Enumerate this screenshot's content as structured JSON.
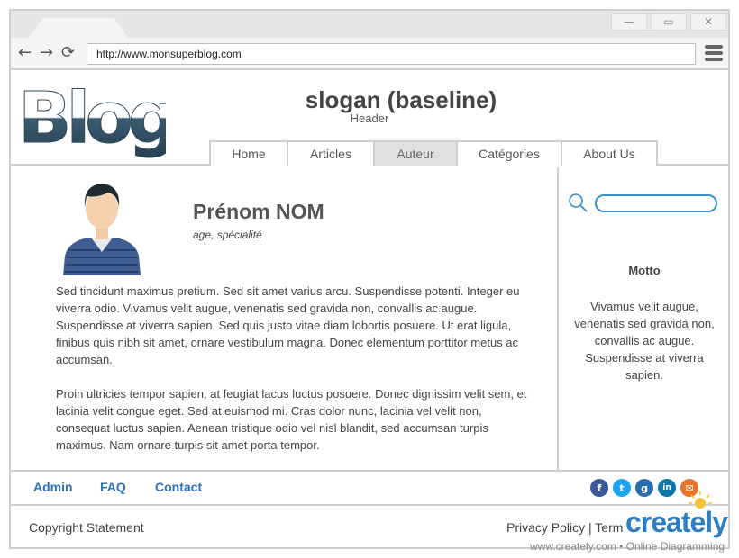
{
  "browser": {
    "url": "http://www.monsuperblog.com",
    "window_controls": [
      "minimize-icon",
      "maximize-icon",
      "close-icon"
    ]
  },
  "header": {
    "logo_text": "Blog",
    "slogan": "slogan (baseline)",
    "label": "Header"
  },
  "nav": {
    "items": [
      {
        "label": "Home",
        "active": false
      },
      {
        "label": "Articles",
        "active": false
      },
      {
        "label": "Auteur",
        "active": true
      },
      {
        "label": "Catégories",
        "active": false
      },
      {
        "label": "About Us",
        "active": false
      }
    ]
  },
  "author": {
    "name": "Prénom NOM",
    "subtitle": "age, spécialité"
  },
  "content": {
    "paragraph1": "Sed tincidunt maximus pretium. Sed sit amet varius arcu. Suspendisse potenti. Integer eu viverra odio. Vivamus velit augue, venenatis sed gravida non, convallis ac augue. Suspendisse at viverra sapien. Sed quis justo vitae diam lobortis posuere. Ut erat ligula, finibus quis nibh sit amet, ornare vestibulum magna. Donec elementum porttitor metus ac accumsan.",
    "paragraph2": "Proin ultricies tempor sapien, at feugiat lacus luctus posuere. Donec dignissim velit sem, et lacinia velit congue eget. Sed at euismod mi. Cras dolor nunc, lacinia vel velit non, consequat luctus sapien. Aenean tristique odio vel nisl blandit, sed accumsan turpis maximus. Nam ornare turpis sit amet porta tempor."
  },
  "sidebar": {
    "motto": "Motto",
    "text": "Vivamus velit augue, venenatis sed gravida non, convallis ac augue. Suspendisse at viverra sapien."
  },
  "footer": {
    "links": [
      "Admin",
      "FAQ",
      "Contact"
    ],
    "social": [
      {
        "icon": "facebook-icon",
        "glyph": "f",
        "color": "#3b5998"
      },
      {
        "icon": "twitter-icon",
        "glyph": "t",
        "color": "#1da1f2"
      },
      {
        "icon": "github-icon",
        "glyph": "g",
        "color": "#2a6db0"
      },
      {
        "icon": "linkedin-icon",
        "glyph": "in",
        "color": "#0e76a8"
      },
      {
        "icon": "email-icon",
        "glyph": "✉",
        "color": "#e8742c"
      }
    ],
    "copyright": "Copyright Statement",
    "policy": "Privacy Policy | Term"
  },
  "watermark": {
    "brand": "creately",
    "sub": "www.creately.com • Online Diagramming"
  },
  "colors": {
    "border": "#cfcfcf",
    "link": "#2f72b8",
    "search_border": "#3a8fc7",
    "nav_active": "#e0e0e0",
    "logo": "#2e4a5e"
  }
}
